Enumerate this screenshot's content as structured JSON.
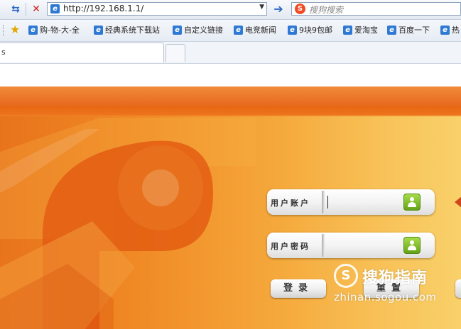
{
  "browser": {
    "address": "http://192.168.1.1/",
    "search_placeholder": "搜狗搜索",
    "tab_title": "s"
  },
  "favorites": [
    {
      "label": "购-物-大-全",
      "icon": "ie-page-icon"
    },
    {
      "label": "经典系统下载站",
      "icon": "ie-page-icon"
    },
    {
      "label": "自定义链接",
      "icon": "ie-page-icon"
    },
    {
      "label": "电竞新闻",
      "icon": "ie-page-icon"
    },
    {
      "label": "9块9包邮",
      "icon": "ie-page-icon"
    },
    {
      "label": "爱淘宝",
      "icon": "ie-page-icon"
    },
    {
      "label": "百度一下",
      "icon": "ie-page-icon"
    },
    {
      "label": "热",
      "icon": "ie-page-icon"
    }
  ],
  "login": {
    "username_label": "用户账户",
    "username_value": "",
    "password_label": "用户密码",
    "password_value": "",
    "login_button": "登录",
    "reset_button": "重置"
  },
  "watermark": {
    "symbol": "S",
    "brand": "搜狗指南",
    "url": "zhinan.sogou.com"
  },
  "colors": {
    "brand_orange": "#e8731b",
    "lock_green": "#62a315"
  }
}
